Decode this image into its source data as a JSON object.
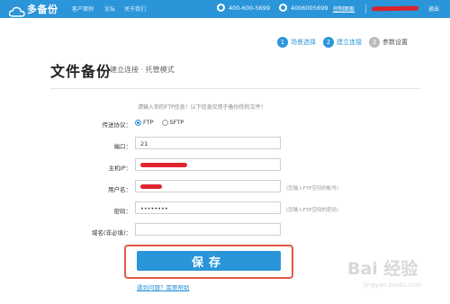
{
  "header": {
    "logo_text": "多备份",
    "nav": [
      "客户案例",
      "论坛",
      "关于我们"
    ],
    "phone_1": "400-600-5699",
    "phone_2": "4006005699",
    "console_link": "控制面板",
    "logout": "退出",
    "accent_color": "#2b95d9"
  },
  "steps": [
    {
      "num": "1",
      "label": "场景选择",
      "active": true
    },
    {
      "num": "2",
      "label": "建立连接",
      "active": true
    },
    {
      "num": "3",
      "label": "参数设置",
      "active": false
    }
  ],
  "page": {
    "title": "文件备份",
    "subtitle": "建立连接 · 托管模式"
  },
  "form": {
    "hint": "请输入你的FTP信息！以下信息仅用于备份你的文件！",
    "protocol_label": "传送协议：",
    "protocol_options": [
      "FTP",
      "SFTP"
    ],
    "protocol_selected": "FTP",
    "port_label": "端口：",
    "port_value": "21",
    "host_label": "主机IP：",
    "username_label": "用户名：",
    "username_hint": "(您输入FTP空间的帐号)",
    "password_label": "密码：",
    "password_value": "••••••••",
    "password_hint": "(您输入FTP空间的密码)",
    "domain_label": "域名(非必填)：",
    "domain_value": ""
  },
  "actions": {
    "save_label": "保存",
    "help_link": "遇到问题？需要帮助"
  },
  "watermark": {
    "text": "Bai 经验",
    "sub": "jingyan.baidu.com"
  }
}
